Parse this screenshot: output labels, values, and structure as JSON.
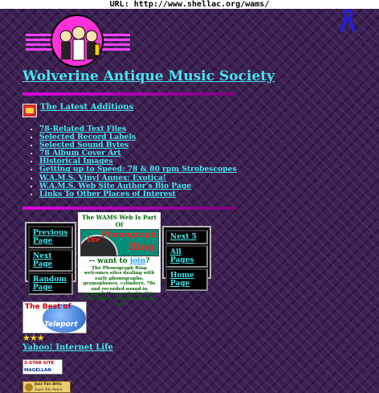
{
  "browser": {
    "url_label": "URL:",
    "url": "http://www.shellac.org/wams/"
  },
  "site": {
    "title": "Wolverine Antique Music Society"
  },
  "latest": {
    "label": "The Latest Additions"
  },
  "links": [
    "78-Related Text Files",
    "Selected Record Labels",
    "Selected Sound Bytes",
    "78 Album Cover Art",
    "Historical Images",
    "Getting up to Speed: 78 & 80 rpm Strobescopes",
    "W.A.M.S. Vinyl Annex: Exotica!",
    "W.A.M.S. Web Site Author's Bio Page",
    "Links To Other Places of Interest"
  ],
  "nav_left": [
    "Previous Page",
    "Next Page",
    "Random Page"
  ],
  "nav_right": [
    "Next 5",
    "All Pages",
    "Home Page"
  ],
  "webring": {
    "header": "The WAMS Web Is Part Of",
    "image_the": "the",
    "image_phonograph": "Phonograph",
    "image_ring": "Ring",
    "want_prefix": "-- want to ",
    "want_join": "join",
    "want_suffix": "?",
    "description": "The Phonograph Ring welcomes sites dealing with early phonographs, gramophones, cylinders, 78s and recorded sound in general. If your site fits this description, consider joining up!"
  },
  "awards": {
    "teleport_best": "The Best of",
    "teleport_name": "Teleport",
    "stars": "★★★",
    "yahoo_label": "Yahoo! Internet Life",
    "magellan_line1": "3-STAR SITE",
    "magellan_line2": "MAGELLAN",
    "jazz_line1": "Jazz Fan Attic",
    "jazz_line2": "Super Site Award"
  },
  "colors": {
    "link": "#46e6ee",
    "background": "#3a2150",
    "rule": "#e000e0"
  }
}
